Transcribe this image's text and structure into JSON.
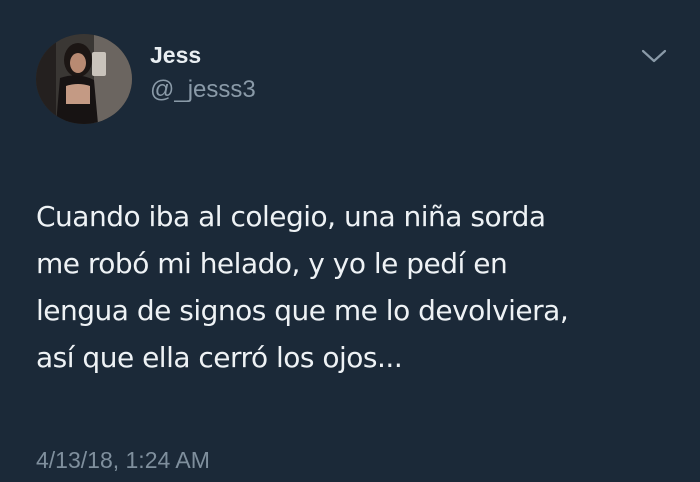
{
  "user": {
    "display_name": "Jess",
    "handle": "@_jesss3",
    "avatar_icon": "profile-photo"
  },
  "menu": {
    "icon": "chevron-down-icon"
  },
  "tweet": {
    "lines": [
      "Cuando iba al colegio, una niña sorda",
      "me robó mi helado, y yo le pedí en",
      "lengua de signos que me lo devolviera,",
      "así que ella cerró los ojos..."
    ],
    "timestamp": "4/13/18, 1:24 AM"
  },
  "colors": {
    "background": "#1b2938",
    "text": "#eef2f5",
    "muted": "#8a9aa8"
  }
}
